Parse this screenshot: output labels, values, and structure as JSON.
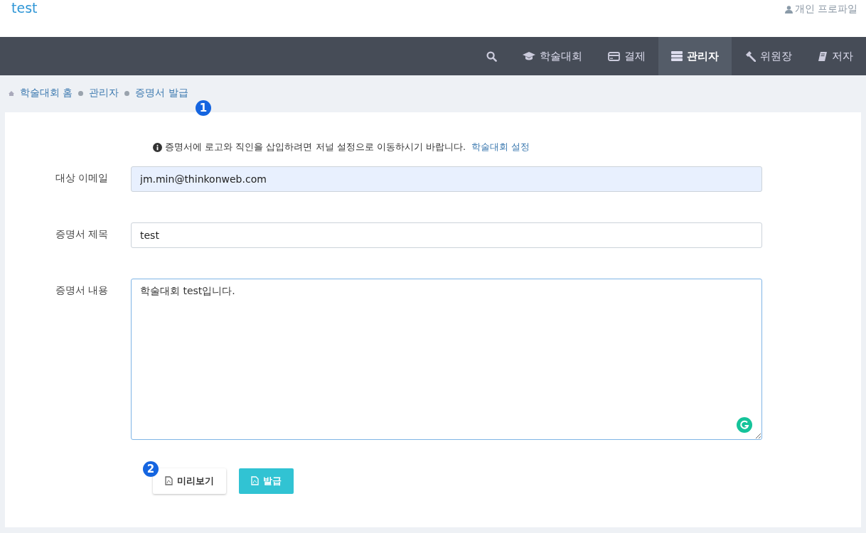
{
  "header": {
    "site_title": "test",
    "profile_link": "개인 프로파일"
  },
  "nav": [
    {
      "kind": "search",
      "selected": false
    },
    {
      "kind": "cap",
      "label": "학술대회",
      "selected": false
    },
    {
      "kind": "card",
      "label": "결제",
      "selected": false
    },
    {
      "kind": "server",
      "label": "관리자",
      "selected": true
    },
    {
      "kind": "gavel",
      "label": "위원장",
      "selected": false
    },
    {
      "kind": "book",
      "label": "저자",
      "selected": false
    }
  ],
  "breadcrumb": [
    "학술대회 홈",
    "관리자",
    "증명서 발급"
  ],
  "markers": [
    "1",
    "2"
  ],
  "notice": {
    "text": "증명서에 로고와 직인을 삽입하려면 저널 설정으로 이동하시기 바랍니다.",
    "link": "학술대회 설정"
  },
  "form": {
    "fields": [
      {
        "kind": "input",
        "label": "대상 이메일",
        "value": "jm.min@thinkonweb.com",
        "autofilled": true
      },
      {
        "kind": "input",
        "label": "증명서 제목",
        "value": "test",
        "autofilled": false
      },
      {
        "kind": "textarea",
        "label": "증명서 내용",
        "value": "학술대회 test입니다."
      }
    ]
  },
  "buttons": [
    {
      "kind": "default",
      "label": "미리보기"
    },
    {
      "kind": "primary",
      "label": "발급"
    }
  ]
}
